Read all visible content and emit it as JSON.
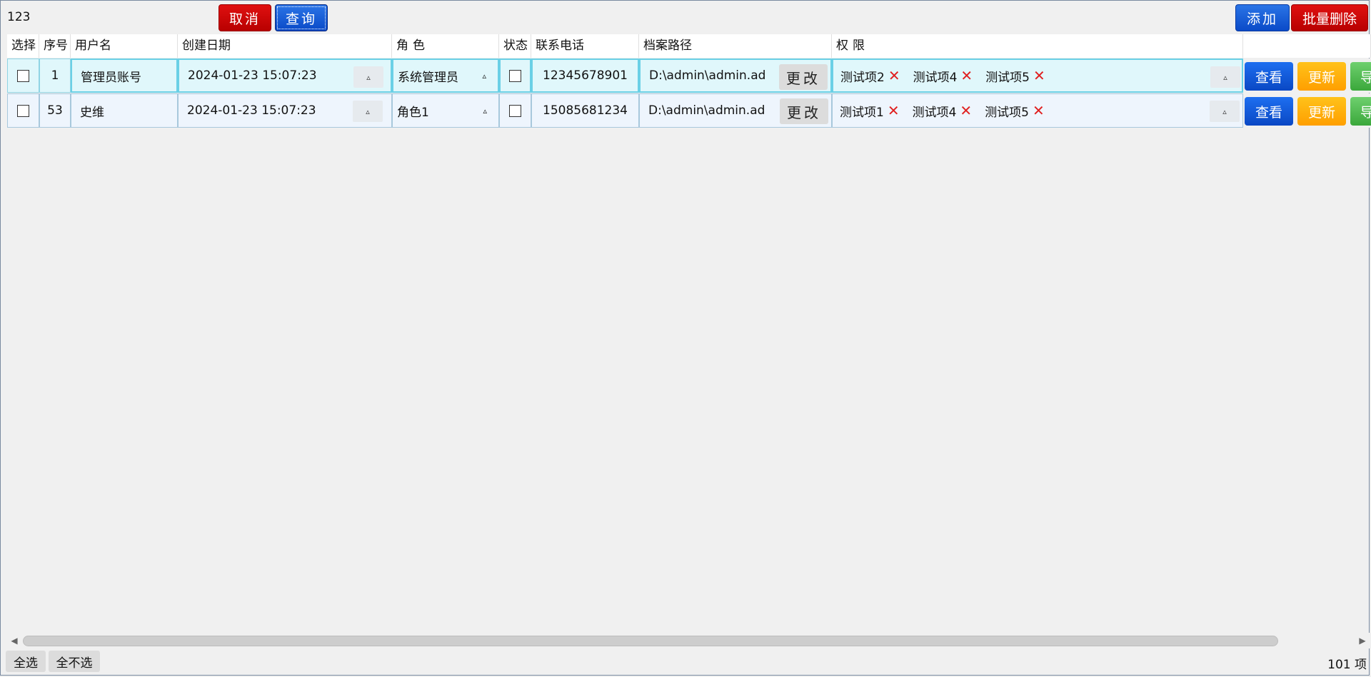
{
  "toolbar": {
    "search_value": "123",
    "cancel_label": "取消",
    "query_label": "查询",
    "add_label": "添加",
    "batch_delete_label": "批量删除"
  },
  "colors": {
    "danger": "#c80000",
    "primary": "#0a4ac8",
    "warning": "#ffb000",
    "success": "#4cb84c",
    "selected_row": "#e0f7fb"
  },
  "table": {
    "headers": {
      "select": "选择",
      "index": "序号",
      "username": "用户名",
      "created": "创建日期",
      "role": "角色",
      "status": "状态",
      "phone": "联系电话",
      "path": "档案路径",
      "permissions": "权限"
    },
    "edit_label": "更改",
    "actions": {
      "view": "查看",
      "update": "更新",
      "export": "导出"
    },
    "rows": [
      {
        "index": "1",
        "username": "管理员账号",
        "created": "2024-01-23 15:07:23",
        "role": "系统管理员",
        "phone": "12345678901",
        "path": "D:\\admin\\admin.ad",
        "permissions": [
          "测试项2",
          "测试项4",
          "测试项5"
        ]
      },
      {
        "index": "53",
        "username": "史维",
        "created": "2024-01-23 15:07:23",
        "role": "角色1",
        "phone": "15085681234",
        "path": "D:\\admin\\admin.ad",
        "permissions": [
          "测试项1",
          "测试项4",
          "测试项5"
        ]
      }
    ]
  },
  "footer": {
    "select_all": "全选",
    "select_none": "全不选",
    "count": "101 项"
  }
}
